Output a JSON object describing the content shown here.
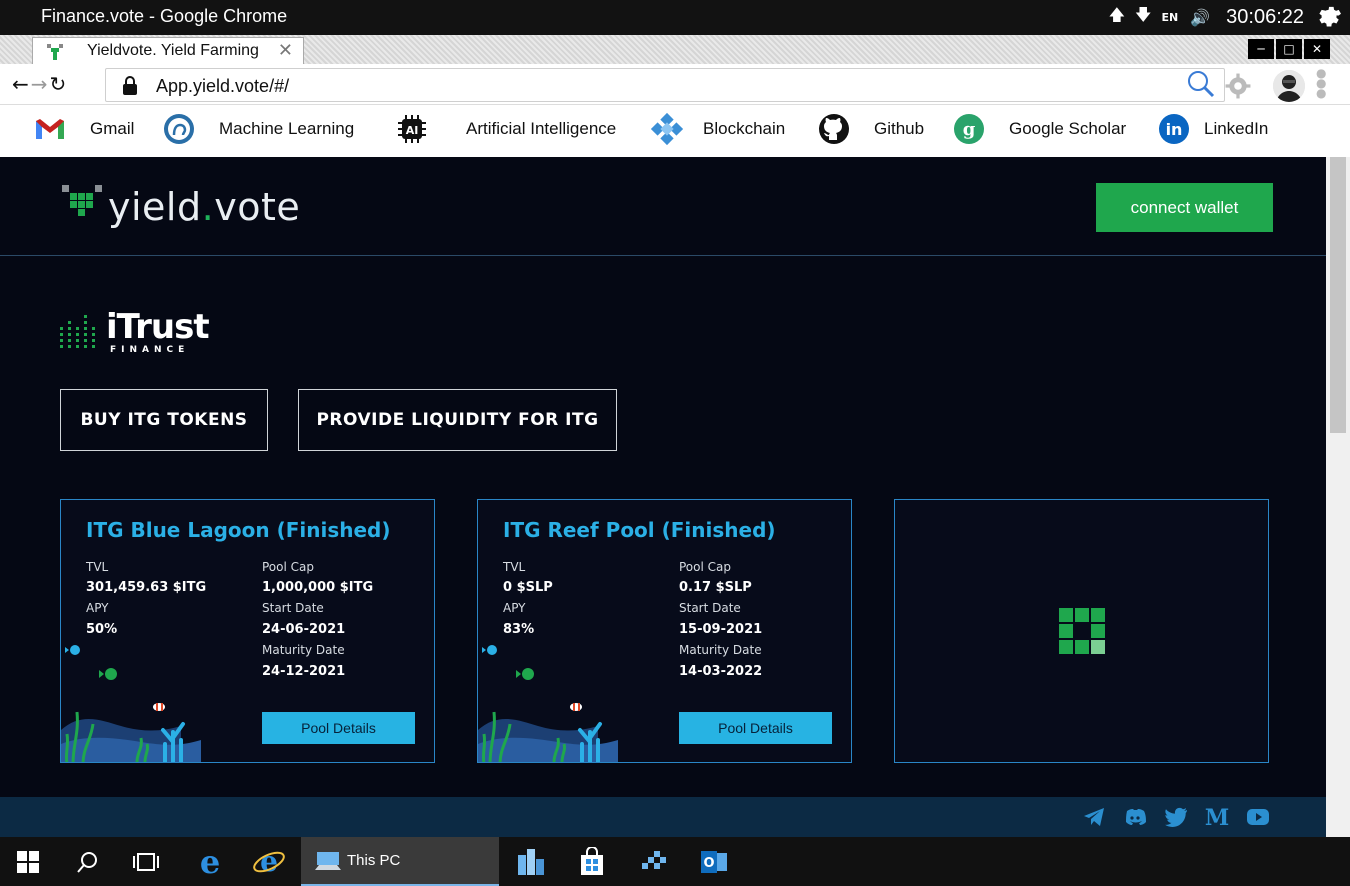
{
  "os": {
    "window_title": "Finance.vote - Google Chrome",
    "keyboard_lang": "EN",
    "clock": "30:06:22"
  },
  "browser": {
    "tab_title": "Yieldvote. Yield Farming",
    "url": "App.yield.vote/#/",
    "bookmarks": [
      {
        "label": "Gmail",
        "icon": "gmail-icon"
      },
      {
        "label": "Machine Learning",
        "icon": "brain-icon"
      },
      {
        "label": "Artificial Intelligence",
        "icon": "ai-chip-icon"
      },
      {
        "label": "Blockchain",
        "icon": "blockchain-icon"
      },
      {
        "label": "Github",
        "icon": "github-icon"
      },
      {
        "label": "Google Scholar",
        "icon": "google-scholar-icon"
      },
      {
        "label": "LinkedIn",
        "icon": "linkedin-icon"
      }
    ]
  },
  "site": {
    "logo_word": "yield",
    "logo_dot": ".",
    "logo_word2": "vote",
    "connect_label": "connect wallet",
    "brand_name": "iTrust",
    "brand_sub": "FINANCE",
    "buy_label": "BUY ITG TOKENS",
    "liquidity_label": "PROVIDE LIQUIDITY FOR ITG",
    "colors": {
      "accent_green": "#1fa74d",
      "accent_blue": "#2bb0e6",
      "background": "#050814"
    }
  },
  "pools": [
    {
      "title": "ITG Blue Lagoon (Finished)",
      "tvl_label": "TVL",
      "tvl": "301,459.63 $ITG",
      "apy_label": "APY",
      "apy": "50%",
      "cap_label": "Pool Cap",
      "cap": "1,000,000 $ITG",
      "start_label": "Start Date",
      "start": "24-06-2021",
      "maturity_label": "Maturity Date",
      "maturity": "24-12-2021",
      "button": "Pool Details"
    },
    {
      "title": "ITG Reef Pool (Finished)",
      "tvl_label": "TVL",
      "tvl": "0 $SLP",
      "apy_label": "APY",
      "apy": "83%",
      "cap_label": "Pool Cap",
      "cap": "0.17 $SLP",
      "start_label": "Start Date",
      "start": "15-09-2021",
      "maturity_label": "Maturity Date",
      "maturity": "14-03-2022",
      "button": "Pool Details"
    }
  ],
  "footer": {
    "social": [
      "telegram-icon",
      "discord-icon",
      "twitter-icon",
      "medium-icon",
      "youtube-icon"
    ]
  },
  "taskbar": {
    "active_label": "This PC"
  }
}
